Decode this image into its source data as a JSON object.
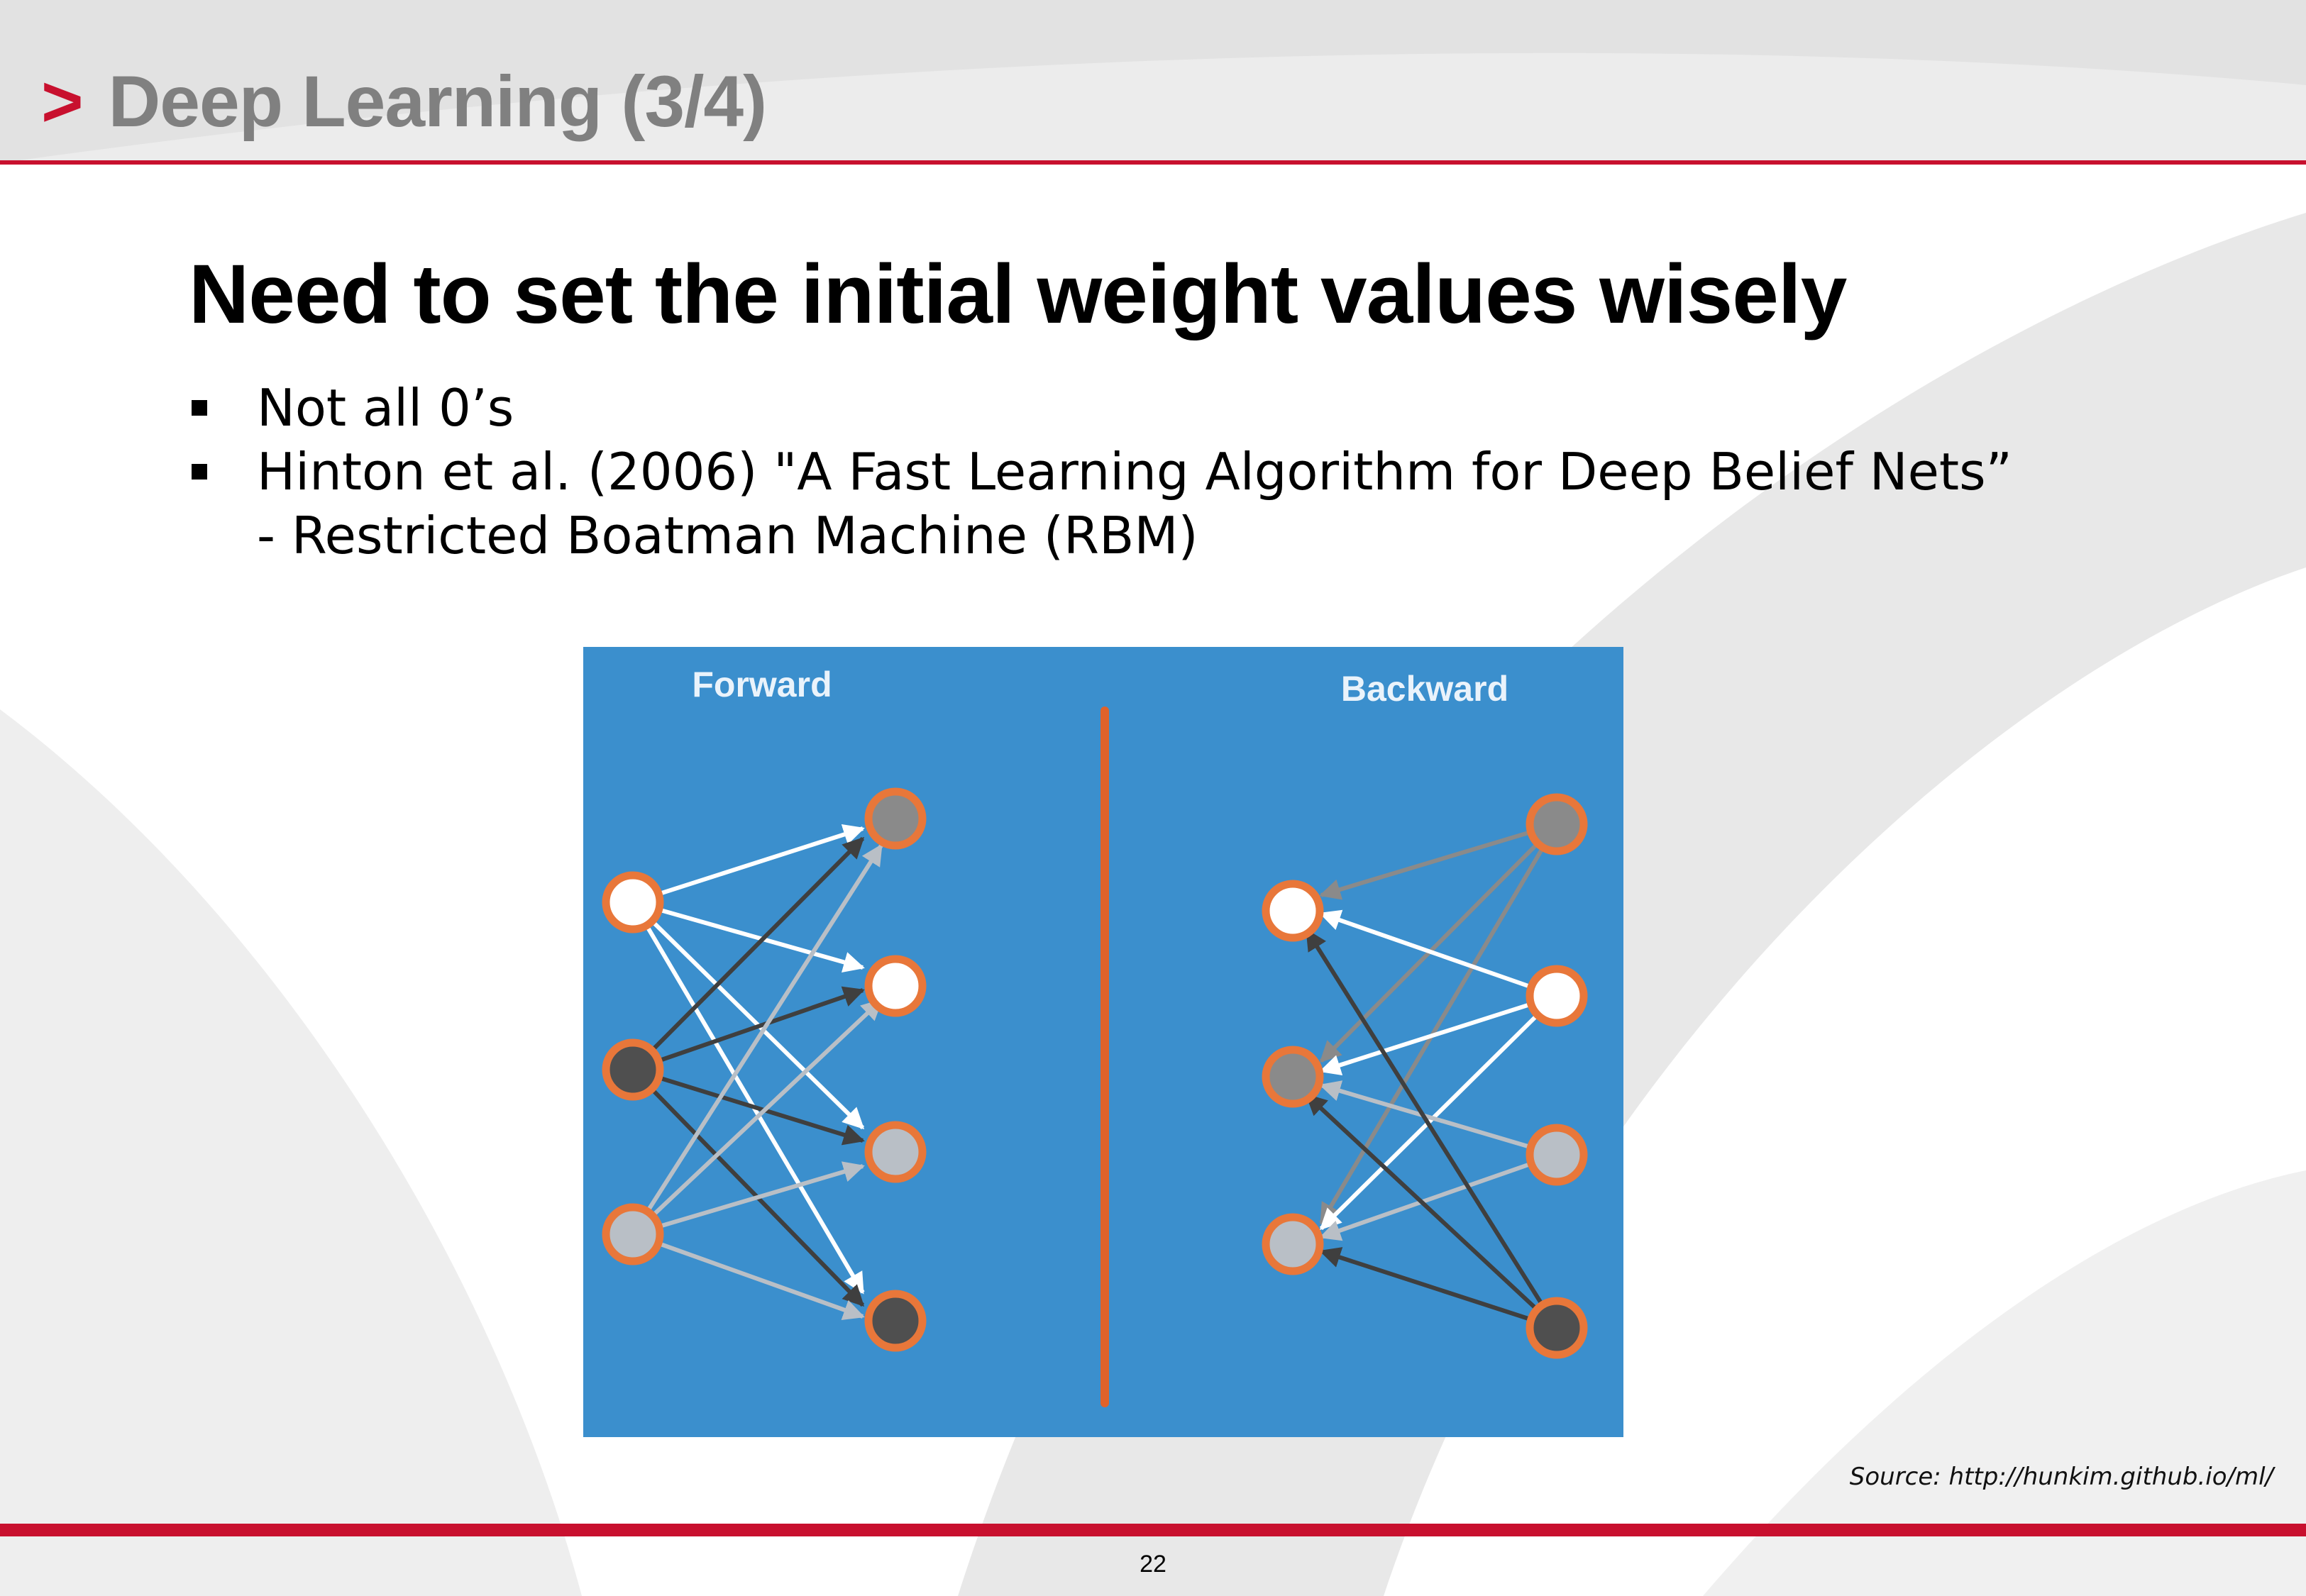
{
  "header": {
    "marker": ">",
    "title": "Deep Learning (3/4)"
  },
  "slide": {
    "heading": "Need to set the initial weight values wisely",
    "bullets": [
      "Not all 0’s",
      "Hinton et al. (2006) \"A Fast Learning Algorithm for Deep Belief Nets”"
    ],
    "sub_bullet": "- Restricted Boatman Machine (RBM)"
  },
  "figure": {
    "forward_label": "Forward",
    "backward_label": "Backward",
    "colors": {
      "background": "#3b8fcd",
      "divider": "#e0622a",
      "node_ring": "#e8773a",
      "white_node": "#ffffff",
      "dark_node": "#4f4f4f",
      "gray_node": "#8a8a8a",
      "light_node": "#b9bfc6"
    }
  },
  "source": "Source: http://hunkim.github.io/ml/",
  "footer": {
    "page_number": "22"
  },
  "colors": {
    "accent": "#c8102e",
    "header_text": "#808080"
  }
}
